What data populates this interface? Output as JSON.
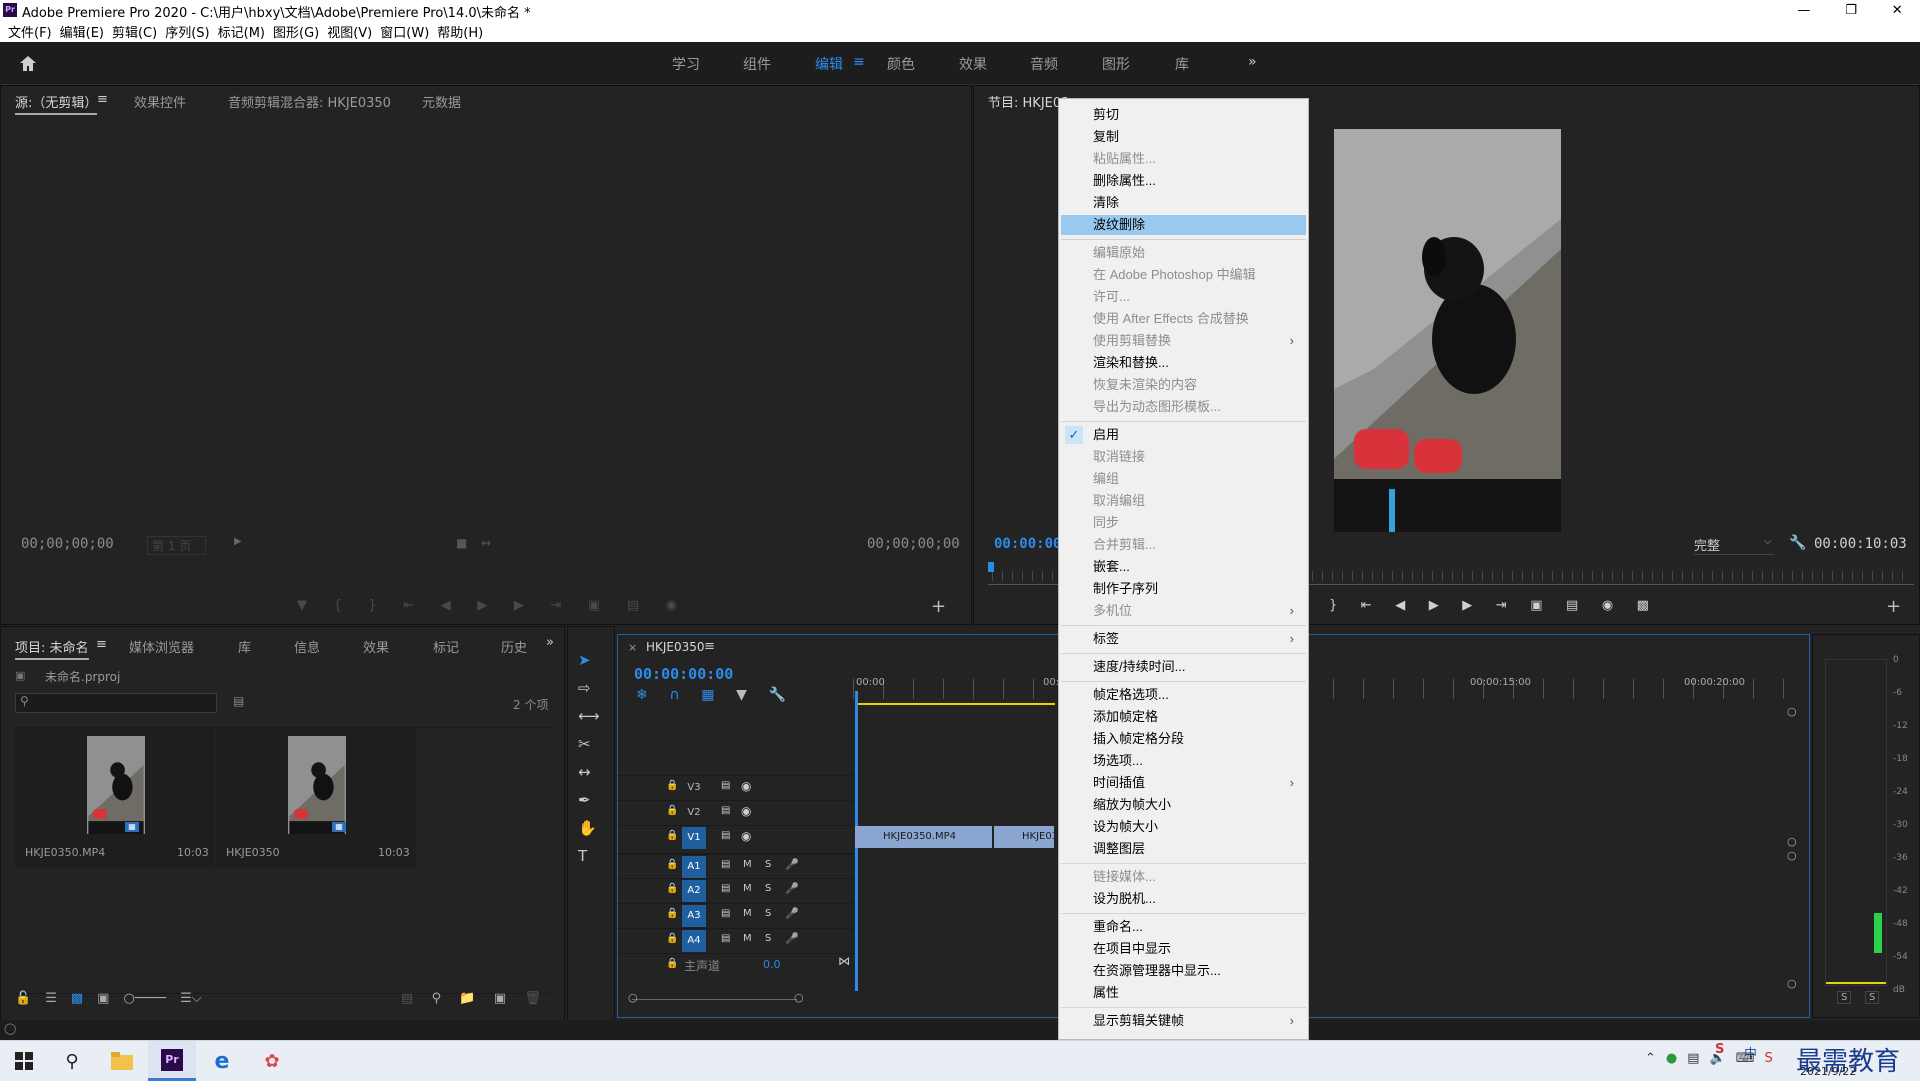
{
  "window": {
    "title": "Adobe Premiere Pro 2020 - C:\\用户\\hbxy\\文档\\Adobe\\Premiere Pro\\14.0\\未命名 *",
    "app_badge": "Pr"
  },
  "menubar": [
    "文件(F)",
    "编辑(E)",
    "剪辑(C)",
    "序列(S)",
    "标记(M)",
    "图形(G)",
    "视图(V)",
    "窗口(W)",
    "帮助(H)"
  ],
  "workspaces": [
    "学习",
    "组件",
    "编辑",
    "颜色",
    "效果",
    "音频",
    "图形",
    "库"
  ],
  "workspace_active": "编辑",
  "source_panel": {
    "tabs": [
      "源:（无剪辑）",
      "效果控件",
      "音频剪辑混合器: HKJE0350",
      "元数据"
    ],
    "tc_left": "00;00;00;00",
    "tc_right": "00;00;00;00",
    "page": "第 1 页"
  },
  "program_panel": {
    "title": "节目: HKJE03",
    "tc_current": "00:00:00:",
    "quality": "完整",
    "tc_duration": "00:00:10:03"
  },
  "project_panel": {
    "tabs": [
      "项目: 未命名",
      "媒体浏览器",
      "库",
      "信息",
      "效果",
      "标记",
      "历史"
    ],
    "file": "未命名.prproj",
    "count": "2 个项",
    "items": [
      {
        "name": "HKJE0350.MP4",
        "duration": "10:03"
      },
      {
        "name": "HKJE0350",
        "duration": "10:03"
      }
    ]
  },
  "timeline": {
    "tab": "HKJE0350",
    "tc": "00:00:00:00",
    "ruler": [
      "00:00",
      "00:",
      "00:00:15:00",
      "00:00:20:00"
    ],
    "video_tracks": [
      "V3",
      "V2",
      "V1"
    ],
    "audio_tracks": [
      "A1",
      "A2",
      "A3",
      "A4"
    ],
    "mute": "M",
    "solo": "S",
    "master": {
      "label": "主声道",
      "value": "0.0"
    },
    "clips": [
      "HKJE0350.MP4",
      "HKJE035"
    ]
  },
  "meter": {
    "scale": [
      "0",
      "-6",
      "-12",
      "-18",
      "-24",
      "-30",
      "-36",
      "-42",
      "-48",
      "-54",
      "dB"
    ],
    "solo": [
      "S",
      "S"
    ]
  },
  "context_menu": [
    {
      "label": "剪切",
      "state": "normal"
    },
    {
      "label": "复制",
      "state": "normal"
    },
    {
      "label": "粘贴属性...",
      "state": "disabled"
    },
    {
      "label": "删除属性...",
      "state": "normal"
    },
    {
      "label": "清除",
      "state": "normal"
    },
    {
      "label": "波纹删除",
      "state": "highlighted"
    },
    {
      "sep": true
    },
    {
      "label": "编辑原始",
      "state": "disabled"
    },
    {
      "label": "在 Adobe Photoshop 中编辑",
      "state": "disabled"
    },
    {
      "label": "许可...",
      "state": "disabled"
    },
    {
      "label": "使用 After Effects 合成替换",
      "state": "disabled"
    },
    {
      "label": "使用剪辑替换",
      "state": "disabled",
      "submenu": true
    },
    {
      "label": "渲染和替换...",
      "state": "normal"
    },
    {
      "label": "恢复未渲染的内容",
      "state": "disabled"
    },
    {
      "label": "导出为动态图形模板...",
      "state": "disabled"
    },
    {
      "sep": true
    },
    {
      "label": "启用",
      "state": "checked"
    },
    {
      "label": "取消链接",
      "state": "disabled"
    },
    {
      "label": "编组",
      "state": "disabled"
    },
    {
      "label": "取消编组",
      "state": "disabled"
    },
    {
      "label": "同步",
      "state": "disabled"
    },
    {
      "label": "合并剪辑...",
      "state": "disabled"
    },
    {
      "label": "嵌套...",
      "state": "normal"
    },
    {
      "label": "制作子序列",
      "state": "normal"
    },
    {
      "label": "多机位",
      "state": "disabled",
      "submenu": true
    },
    {
      "sep": true
    },
    {
      "label": "标签",
      "state": "normal",
      "submenu": true
    },
    {
      "sep": true
    },
    {
      "label": "速度/持续时间...",
      "state": "normal"
    },
    {
      "sep": true
    },
    {
      "label": "帧定格选项...",
      "state": "normal"
    },
    {
      "label": "添加帧定格",
      "state": "normal"
    },
    {
      "label": "插入帧定格分段",
      "state": "normal"
    },
    {
      "label": "场选项...",
      "state": "normal"
    },
    {
      "label": "时间插值",
      "state": "normal",
      "submenu": true
    },
    {
      "label": "缩放为帧大小",
      "state": "normal"
    },
    {
      "label": "设为帧大小",
      "state": "normal"
    },
    {
      "label": "调整图层",
      "state": "normal"
    },
    {
      "sep": true
    },
    {
      "label": "链接媒体...",
      "state": "disabled"
    },
    {
      "label": "设为脱机...",
      "state": "normal"
    },
    {
      "sep": true
    },
    {
      "label": "重命名...",
      "state": "normal"
    },
    {
      "label": "在项目中显示",
      "state": "normal"
    },
    {
      "label": "在资源管理器中显示...",
      "state": "normal"
    },
    {
      "label": "属性",
      "state": "normal"
    },
    {
      "sep": true
    },
    {
      "label": "显示剪辑关键帧",
      "state": "normal",
      "submenu": true
    }
  ],
  "taskbar": {
    "date": "2021/9/22",
    "tray_ime": "中",
    "watermark": "最需教育"
  },
  "colors": {
    "accent": "#2d8ceb",
    "highlight": "#99c9ef",
    "clip": "#8aa5cf",
    "track_on": "#1e5fa0"
  }
}
